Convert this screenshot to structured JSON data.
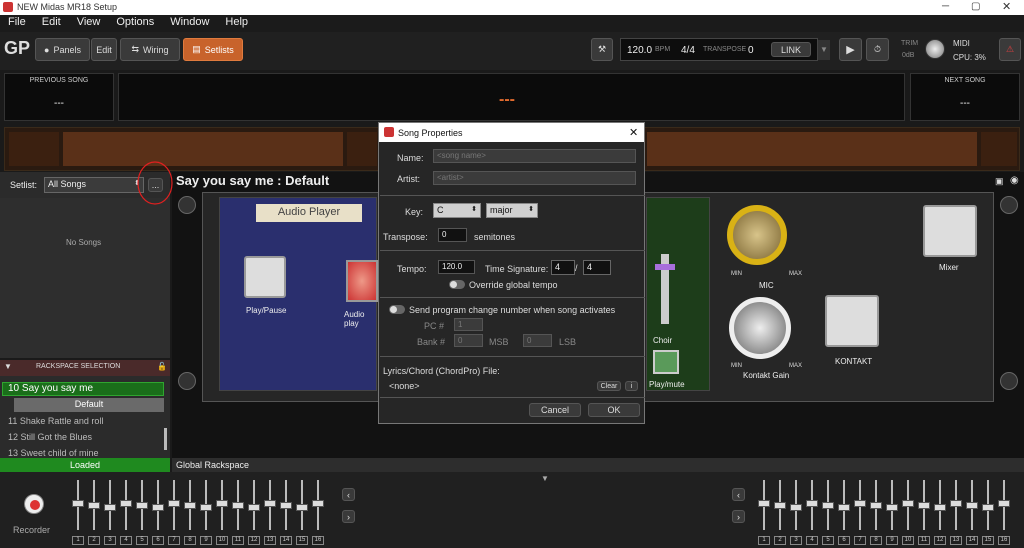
{
  "window": {
    "title": "NEW Midas MR18 Setup"
  },
  "menu": [
    "File",
    "Edit",
    "View",
    "Options",
    "Window",
    "Help"
  ],
  "toolbar": {
    "panels": "Panels",
    "edit": "Edit",
    "wiring": "Wiring",
    "setlists": "Setlists",
    "tempo": "120.0",
    "bpm": "BPM",
    "timesig": "4/4",
    "transpose_label": "TRANSPOSE",
    "transpose_value": "0",
    "link": "LINK",
    "trim": "TRIM",
    "trim_db": "0dB",
    "midi": "MIDI",
    "cpu": "CPU: 3%"
  },
  "song_nav": {
    "previous_label": "PREVIOUS SONG",
    "previous_value": "---",
    "next_label": "NEXT SONG",
    "next_value": "---",
    "current": "---"
  },
  "setlist": {
    "label": "Setlist:",
    "value": "All Songs",
    "more": "...",
    "empty": "No Songs"
  },
  "rackspace_selection": {
    "header": "RACKSPACE SELECTION",
    "items": [
      {
        "label": "10  Say you say me"
      },
      {
        "label": "11  Shake Rattle and roll"
      },
      {
        "label": "12  Still Got the Blues"
      },
      {
        "label": "13  Sweet child of mine"
      }
    ],
    "variation": "Default",
    "loaded": "Loaded"
  },
  "rack": {
    "title": "Say you say me : Default",
    "audio_player": "Audio Player",
    "play_pause": "Play/Pause",
    "audio_play": "Audio play",
    "choir": "Choir",
    "play_mute": "Play/mute",
    "mic": "MIC",
    "min": "MIN",
    "max": "MAX",
    "kontakt_gain": "Kontakt Gain",
    "mixer": "Mixer",
    "kontakt": "KONTAKT"
  },
  "global_rackspace": "Global Rackspace",
  "recorder": "Recorder",
  "dialog": {
    "title": "Song Properties",
    "name_label": "Name:",
    "name_placeholder": "<song name>",
    "artist_label": "Artist:",
    "artist_placeholder": "<artist>",
    "key_label": "Key:",
    "key_value": "C",
    "mode_value": "major",
    "transpose_label": "Transpose:",
    "transpose_value": "0",
    "transpose_unit": "semitones",
    "tempo_label": "Tempo:",
    "tempo_value": "120.0",
    "timesig_label": "Time Signature:",
    "timesig_num": "4",
    "timesig_den": "4",
    "override_label": "Override global tempo",
    "program_change_label": "Send program change number when song activates",
    "pc_label": "PC #",
    "pc_value": "1",
    "bank_label": "Bank #",
    "bank_msb": "0",
    "msb": "MSB",
    "bank_lsb": "0",
    "lsb": "LSB",
    "lyrics_label": "Lyrics/Chord (ChordPro) File:",
    "lyrics_value": "<none>",
    "clear": "Clear",
    "cancel": "Cancel",
    "ok": "OK"
  },
  "channel_numbers_left": [
    "1",
    "2",
    "3",
    "4",
    "5",
    "6",
    "7",
    "8",
    "9",
    "10",
    "11",
    "12",
    "13",
    "14",
    "15",
    "16"
  ],
  "channel_numbers_right": [
    "1",
    "2",
    "3",
    "4",
    "5",
    "6",
    "7",
    "8",
    "9",
    "10",
    "11",
    "12",
    "13",
    "14",
    "15",
    "16"
  ],
  "colors": {
    "accent": "#c8632b",
    "green": "#1f8a1f",
    "rack_blue": "#2a2f6e",
    "rack_green": "#1d3d1a"
  }
}
